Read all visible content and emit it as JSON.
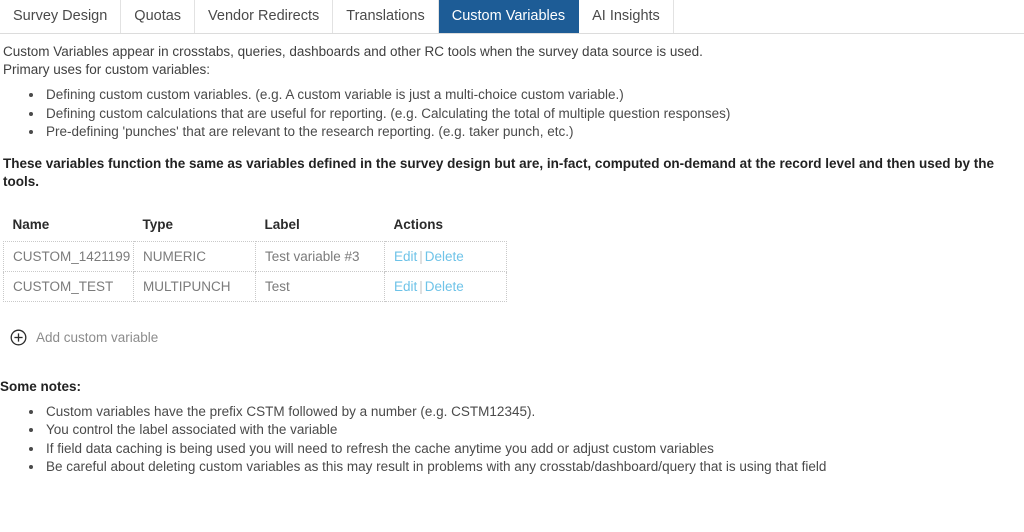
{
  "tabs": [
    {
      "label": "Survey Design",
      "active": false
    },
    {
      "label": "Quotas",
      "active": false
    },
    {
      "label": "Vendor Redirects",
      "active": false
    },
    {
      "label": "Translations",
      "active": false
    },
    {
      "label": "Custom Variables",
      "active": true
    },
    {
      "label": "AI Insights",
      "active": false
    }
  ],
  "intro": {
    "line1": "Custom Variables appear in crosstabs, queries, dashboards and other RC tools when the survey data source is used.",
    "line2": "Primary uses for custom variables:"
  },
  "primary_uses": [
    "Defining custom custom variables. (e.g. A custom variable is just a multi-choice custom variable.)",
    "Defining custom calculations that are useful for reporting. (e.g. Calculating the total of multiple question responses)",
    "Pre-defining 'punches' that are relevant to the research reporting. (e.g. taker punch, etc.)"
  ],
  "bold_note": "These variables function the same as variables defined in the survey design but are, in-fact, computed on-demand at the record level and then used by the tools.",
  "table": {
    "headers": [
      "Name",
      "Type",
      "Label",
      "Actions"
    ],
    "rows": [
      {
        "name": "CUSTOM_1421199",
        "type": "NUMERIC",
        "label": "Test variable #3",
        "edit_label": "Edit",
        "separator": "|",
        "delete_label": "Delete"
      },
      {
        "name": "CUSTOM_TEST",
        "type": "MULTIPUNCH",
        "label": "Test",
        "edit_label": "Edit",
        "separator": "|",
        "delete_label": "Delete"
      }
    ]
  },
  "add_variable": {
    "icon": "plus-circle-icon",
    "label": "Add custom variable"
  },
  "notes": {
    "title": "Some notes:",
    "items": [
      "Custom variables have the prefix CSTM followed by a number (e.g. CSTM12345).",
      "You control the label associated with the variable",
      "If field data caching is being used you will need to refresh the cache anytime you add or adjust custom variables",
      "Be careful about deleting custom variables as this may result in problems with any crosstab/dashboard/query that is using that field"
    ]
  },
  "colors": {
    "active_tab_bg": "#1d5c96",
    "link_blue": "#6ec3e8",
    "text_gray": "#7b7b7b",
    "border_gray": "#dcdcdc"
  }
}
